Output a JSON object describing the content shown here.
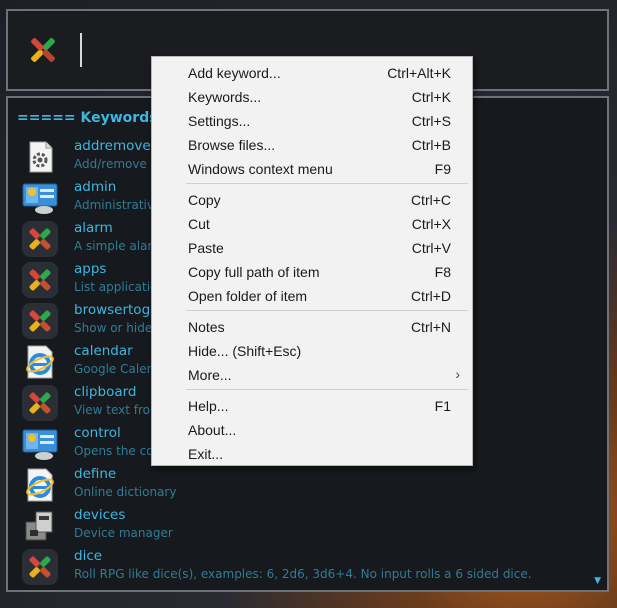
{
  "launcher": {
    "input_value": ""
  },
  "results": {
    "header": "===== Keywords",
    "items": [
      {
        "name": "addremove",
        "desc": "Add/remove p",
        "icon": "gear-doc-icon"
      },
      {
        "name": "admin",
        "desc": "Administrative",
        "icon": "admin-panel-icon"
      },
      {
        "name": "alarm",
        "desc": "A simple alarm",
        "icon": "app-x-icon"
      },
      {
        "name": "apps",
        "desc": "List applicatio",
        "icon": "app-x-icon"
      },
      {
        "name": "browsertoggle",
        "desc": "Show or hide",
        "icon": "app-x-icon"
      },
      {
        "name": "calendar",
        "desc": "Google Calend",
        "icon": "ie-icon"
      },
      {
        "name": "clipboard",
        "desc": "View text from",
        "icon": "app-x-icon"
      },
      {
        "name": "control",
        "desc": "Opens the co",
        "icon": "admin-panel-icon"
      },
      {
        "name": "define",
        "desc": "Online dictionary",
        "icon": "ie-icon"
      },
      {
        "name": "devices",
        "desc": "Device manager",
        "icon": "devices-icon"
      },
      {
        "name": "dice",
        "desc": "Roll RPG like dice(s), examples: 6, 2d6, 3d6+4. No input rolls a 6 sided dice.",
        "icon": "app-x-icon"
      }
    ]
  },
  "context_menu": {
    "groups": [
      [
        {
          "label": "Add keyword...",
          "shortcut": "Ctrl+Alt+K"
        },
        {
          "label": "Keywords...",
          "shortcut": "Ctrl+K"
        },
        {
          "label": "Settings...",
          "shortcut": "Ctrl+S"
        },
        {
          "label": "Browse files...",
          "shortcut": "Ctrl+B"
        },
        {
          "label": "Windows context menu",
          "shortcut": "F9"
        }
      ],
      [
        {
          "label": "Copy",
          "shortcut": "Ctrl+C"
        },
        {
          "label": "Cut",
          "shortcut": "Ctrl+X"
        },
        {
          "label": "Paste",
          "shortcut": "Ctrl+V"
        },
        {
          "label": "Copy full path of item",
          "shortcut": "F8"
        },
        {
          "label": "Open folder of item",
          "shortcut": "Ctrl+D"
        }
      ],
      [
        {
          "label": "Notes",
          "shortcut": "Ctrl+N"
        },
        {
          "label": "Hide...    (Shift+Esc)",
          "shortcut": ""
        },
        {
          "label": "More...",
          "shortcut": "",
          "submenu": true
        }
      ],
      [
        {
          "label": "Help...",
          "shortcut": "F1"
        },
        {
          "label": "About...",
          "shortcut": ""
        },
        {
          "label": "Exit...",
          "shortcut": ""
        }
      ]
    ]
  },
  "colors": {
    "accent": "#3fb7e0",
    "description": "#2f7d96",
    "panel_bg": "#16191d",
    "menu_bg": "#f2f2f2"
  }
}
